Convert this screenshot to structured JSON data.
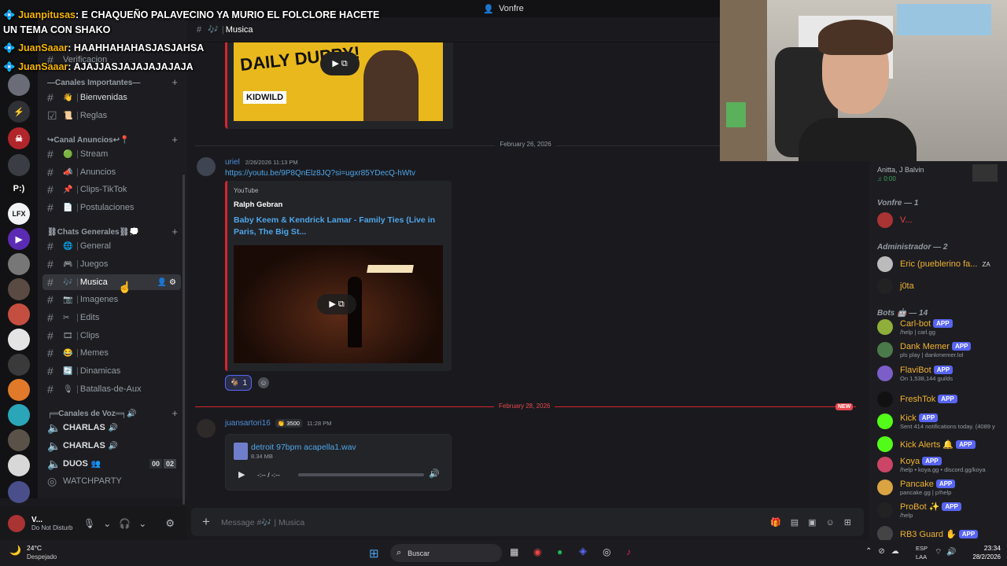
{
  "window_title": "Vonfre",
  "chat_overlay": [
    {
      "name": "Juanpitusas",
      "text": ": E CHAQUEÑO PALAVECINO YA MURIO EL FOLCLORE HACETE"
    },
    {
      "name": "",
      "text": "UN TEMA CON SHAKO"
    },
    {
      "name": "JuanSaaar",
      "text": ": HAAHHAHAHASJASJAHSA"
    },
    {
      "name": "JuanSaaar",
      "text": ": AJAJJASJAJAJAJAJAJA"
    }
  ],
  "sidebar": {
    "top_channel": "Verificacion",
    "categories": [
      {
        "label": "—Canales Importantes—",
        "channels": [
          {
            "emoji": "👋",
            "name": "Bienvenidas"
          },
          {
            "emoji": "📜",
            "name": "Reglas"
          }
        ]
      },
      {
        "label": "↪Canal Anuncios↩📍",
        "channels": [
          {
            "emoji": "🟢",
            "name": "Stream"
          },
          {
            "emoji": "📣",
            "name": "Anuncios"
          },
          {
            "emoji": "📌",
            "name": "Clips-TikTok"
          },
          {
            "emoji": "📄",
            "name": "Postulaciones"
          }
        ]
      },
      {
        "label": "⛓Chats Generales⛓💭",
        "channels": [
          {
            "emoji": "🌐",
            "name": "General"
          },
          {
            "emoji": "🎮",
            "name": "Juegos"
          },
          {
            "emoji": "🎶",
            "name": "Musica"
          },
          {
            "emoji": "📷",
            "name": "Imagenes"
          },
          {
            "emoji": "✂",
            "name": "Edits"
          },
          {
            "emoji": "🎞",
            "name": "Clips"
          },
          {
            "emoji": "😂",
            "name": "Memes"
          },
          {
            "emoji": "🔄",
            "name": "Dinamicas"
          },
          {
            "emoji": "🎙",
            "name": "Batallas-de-Aux"
          }
        ]
      },
      {
        "label": "╒═Canales de Voz═╕🔊",
        "channels": [
          {
            "emoji": "🔊",
            "name": "CHARLAS"
          },
          {
            "emoji": "🔊",
            "name": "CHARLAS"
          },
          {
            "emoji": "👥",
            "name": "DUOS",
            "counts": [
              "00",
              "02"
            ]
          },
          {
            "emoji": "",
            "name": "WATCHPARTY"
          }
        ]
      }
    ]
  },
  "server_icons": [
    "P:)",
    "LFX"
  ],
  "header": {
    "channel": "Musica"
  },
  "user": {
    "name": "V...",
    "status": "Do Not Disturb"
  },
  "messages": {
    "embed1": {
      "brand": "DAILY DUPPY!",
      "sub": "KIDWILD"
    },
    "date1": "February 26, 2026",
    "msg2": {
      "author": "uriel",
      "time": "2/26/2026 11:13 PM",
      "link": "https://youtu.be/9P8QnElz8JQ?si=ugxr85YDecQ-hWtv",
      "provider": "YouTube",
      "channel": "Ralph Gebran",
      "title": "Baby Keem & Kendrick Lamar - Family Ties (Live in Paris, The Big St...",
      "reaction_count": "1"
    },
    "date2": "February 28, 2026",
    "new_badge": "NEW",
    "msg3": {
      "author": "juansartori16",
      "badge": "3500",
      "time": "11:28 PM",
      "file": "detroit 97bpm acapella1.wav",
      "size": "8.34 MB",
      "player_time": "-:-- / -:--"
    }
  },
  "composer": {
    "placeholder": "Message #🎶 | Musica"
  },
  "members": {
    "activity": {
      "artists": "Anitta, J Balvin",
      "time": "0:00"
    },
    "groups": [
      {
        "label": "Vonfre — 1",
        "members": [
          {
            "name": "V...",
            "color": "#f23f43"
          }
        ]
      },
      {
        "label": "Administrador — 2",
        "members": [
          {
            "name": "Eric (pueblerino fa...",
            "tag": "ZA",
            "color": "#f0b232"
          },
          {
            "name": "j0ta",
            "color": "#f0b232"
          }
        ]
      },
      {
        "label": "Bots 🤖 — 14",
        "members": [
          {
            "name": "Carl-bot",
            "sub": "/help | carl.gg",
            "color": "#f0b232"
          },
          {
            "name": "Dank Memer",
            "sub": "pls play | dankmemer.lol",
            "color": "#f0b232"
          },
          {
            "name": "FlaviBot",
            "sub": "On 1,538,144 guilds",
            "color": "#f0b232"
          },
          {
            "name": "FreshTok",
            "sub": "",
            "color": "#f0b232"
          },
          {
            "name": "Kick",
            "sub": "Sent 414 notifications today. (4089 y",
            "color": "#f0b232"
          },
          {
            "name": "Kick Alerts 🔔",
            "sub": "",
            "color": "#f0b232"
          },
          {
            "name": "Koya",
            "sub": "/help • koya.gg • discord.gg/koya",
            "color": "#f0b232"
          },
          {
            "name": "Pancake",
            "sub": "pancake.gg | p!help",
            "color": "#f0b232"
          },
          {
            "name": "ProBot ✨",
            "sub": "/help",
            "color": "#f0b232"
          },
          {
            "name": "RB3 Guard ✋",
            "sub": "",
            "color": "#f0b232"
          }
        ]
      }
    ],
    "app_label": "APP"
  },
  "taskbar": {
    "weather_temp": "24°C",
    "weather_desc": "Despejado",
    "search": "Buscar",
    "lang1": "ESP",
    "lang2": "LAA",
    "time": "23:34",
    "date": "28/2/2026"
  }
}
